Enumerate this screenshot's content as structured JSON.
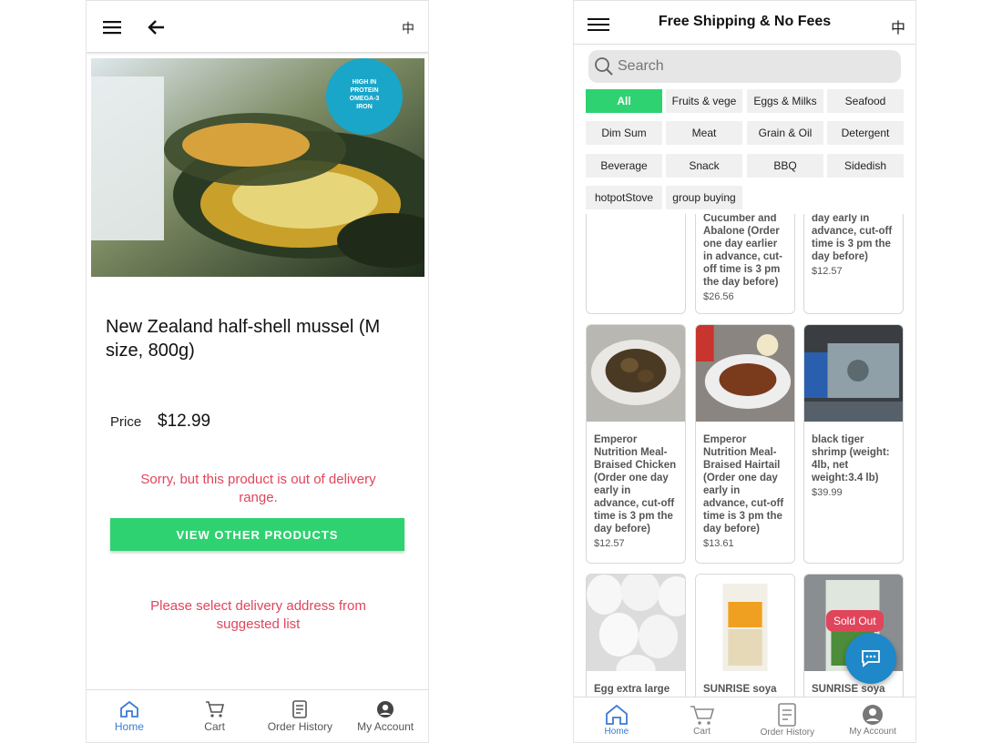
{
  "left": {
    "lang_label": "中",
    "product": {
      "badge_lines": [
        "HIGH IN",
        "PROTEIN",
        "OMEGA-3",
        "IRON"
      ],
      "title": "New Zealand half-shell mussel (M size, 800g)",
      "price_label": "Price",
      "price": "$12.99"
    },
    "warning_range": "Sorry, but this product is out of delivery range.",
    "view_other_button": "VIEW OTHER PRODUCTS",
    "warning_address": "Please select delivery address from suggested list",
    "nav": [
      {
        "label": "Home",
        "icon": "home-icon",
        "active": true
      },
      {
        "label": "Cart",
        "icon": "cart-icon",
        "active": false
      },
      {
        "label": "Order History",
        "icon": "order-history-icon",
        "active": false
      },
      {
        "label": "My Account",
        "icon": "account-icon",
        "active": false
      }
    ]
  },
  "right": {
    "header_title": "Free Shipping & No Fees",
    "lang_label": "中",
    "search_placeholder": "Search",
    "categories": [
      "All",
      "Fruits & vege",
      "Eggs & Milks",
      "Seafood",
      "Dim Sum",
      "Meat",
      "Grain & Oil",
      "Detergent",
      "Beverage",
      "Snack",
      "BBQ",
      "Sidedish",
      "hotpotStove",
      "group buying"
    ],
    "active_category": "All",
    "products_top": [
      {
        "name": "",
        "price": ""
      },
      {
        "name": "Cucumber and Abalone (Order one day earlier in advance, cut-off time is 3 pm the day before)",
        "price": "$26.56"
      },
      {
        "name": "day early in advance, cut-off time is 3 pm the day before)",
        "price": "$12.57"
      }
    ],
    "products_mid": [
      {
        "name": "Emperor Nutrition Meal-Braised Chicken (Order one day early in advance, cut-off time is 3 pm the day before)",
        "price": "$12.57"
      },
      {
        "name": "Emperor Nutrition Meal-Braised Hairtail (Order one day early in advance, cut-off time is 3 pm the day before)",
        "price": "$13.61"
      },
      {
        "name": "black tiger shrimp (weight: 4lb, net weight:3.4 lb)",
        "price": "$39.99"
      }
    ],
    "products_bottom": [
      {
        "name": "Egg extra large",
        "price": ""
      },
      {
        "name": "SUNRISE soya",
        "price": ""
      },
      {
        "name": "SUNRISE soya",
        "price": ""
      }
    ],
    "sold_out_label": "Sold Out",
    "nav": [
      {
        "label": "Home",
        "icon": "home-icon",
        "active": true
      },
      {
        "label": "Cart",
        "icon": "cart-icon",
        "active": false
      },
      {
        "label": "Order History",
        "icon": "order-history-icon",
        "active": false
      },
      {
        "label": "My Account",
        "icon": "account-icon",
        "active": false
      }
    ]
  },
  "colors": {
    "accent_green": "#2fd270",
    "warning_red": "#e0455c",
    "nav_active_blue": "#3a7bd5",
    "chat_blue": "#1e88c9"
  }
}
